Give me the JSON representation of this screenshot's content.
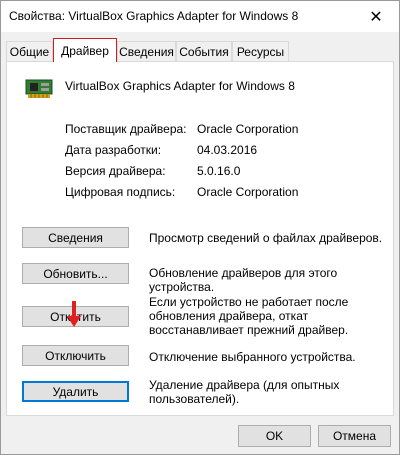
{
  "window": {
    "title": "Свойства: VirtualBox Graphics Adapter for Windows 8",
    "close_glyph": "✕"
  },
  "tabs": [
    {
      "label": "Общие"
    },
    {
      "label": "Драйвер"
    },
    {
      "label": "Сведения"
    },
    {
      "label": "События"
    },
    {
      "label": "Ресурсы"
    }
  ],
  "active_tab": "Драйвер",
  "device": {
    "icon": "graphics-card-icon",
    "name": "VirtualBox Graphics Adapter for Windows 8"
  },
  "info": [
    {
      "label": "Поставщик драйвера:",
      "value": "Oracle Corporation"
    },
    {
      "label": "Дата разработки:",
      "value": "04.03.2016"
    },
    {
      "label": "Версия драйвера:",
      "value": "5.0.16.0"
    },
    {
      "label": "Цифровая подпись:",
      "value": "Oracle Corporation"
    }
  ],
  "actions": [
    {
      "button": "Сведения",
      "description": "Просмотр сведений о файлах драйверов."
    },
    {
      "button": "Обновить...",
      "description": "Обновление драйверов для этого устройства."
    },
    {
      "button": "Откатить",
      "description": "Если устройство не работает после обновления драйвера, откат восстанавливает прежний драйвер."
    },
    {
      "button": "Отключить",
      "description": "Отключение выбранного устройства."
    },
    {
      "button": "Удалить",
      "description": "Удаление драйвера (для опытных пользователей)."
    }
  ],
  "footer": {
    "ok_label": "OK",
    "cancel_label": "Отмена"
  },
  "colors": {
    "active_tab_border": "#cc1f1f",
    "arrow": "#e02020",
    "focus": "#0078d7"
  }
}
